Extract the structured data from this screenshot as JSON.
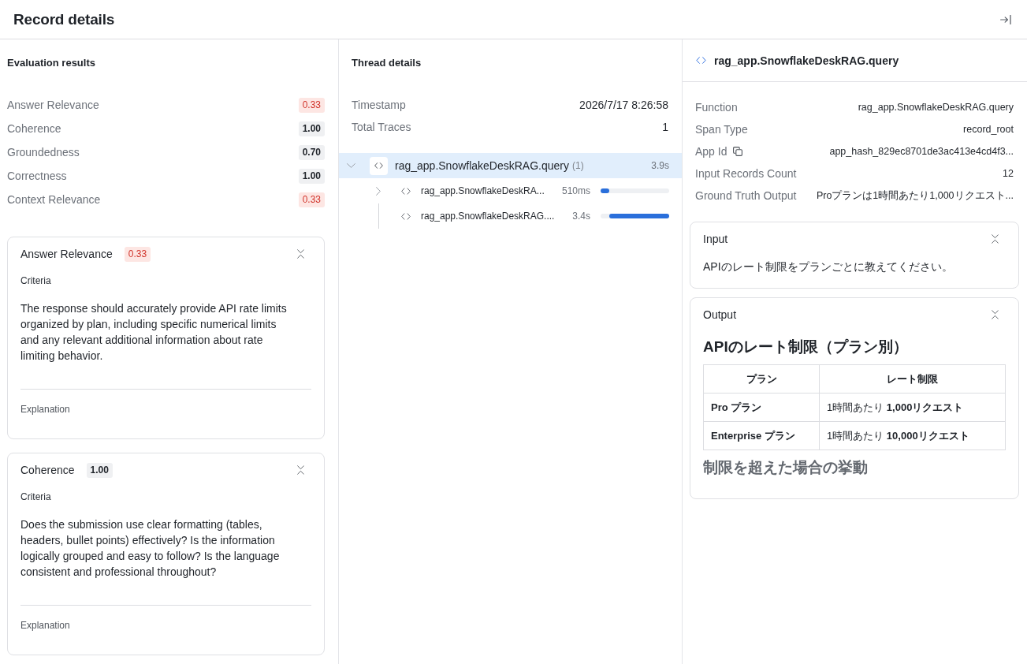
{
  "header": {
    "title": "Record details"
  },
  "evaluation": {
    "title": "Evaluation results",
    "scores": [
      {
        "name": "Answer Relevance",
        "score": "0.33",
        "flagged": true
      },
      {
        "name": "Coherence",
        "score": "1.00",
        "flagged": false
      },
      {
        "name": "Groundedness",
        "score": "0.70",
        "flagged": false
      },
      {
        "name": "Correctness",
        "score": "1.00",
        "flagged": false
      },
      {
        "name": "Context Relevance",
        "score": "0.33",
        "flagged": true
      }
    ],
    "cards": [
      {
        "name": "Answer Relevance",
        "score": "0.33",
        "flagged": true,
        "expanded": true,
        "criteria_label": "Criteria",
        "criteria": "The response should accurately provide API rate limits organized by plan, including specific numerical limits and any relevant additional information about rate limiting behavior.",
        "explanation_label": "Explanation"
      },
      {
        "name": "Coherence",
        "score": "1.00",
        "flagged": false,
        "expanded": true,
        "criteria_label": "Criteria",
        "criteria": "Does the submission use clear formatting (tables, headers, bullet points) effectively? Is the information logically grouped and easy to follow? Is the language consistent and professional throughout?",
        "explanation_label": "Explanation"
      }
    ]
  },
  "thread": {
    "title": "Thread details",
    "properties": [
      {
        "label": "Timestamp",
        "value": "2026/7/17 8:26:58"
      },
      {
        "label": "Total Traces",
        "value": "1"
      }
    ],
    "spans": [
      {
        "name": "rag_app.SnowflakeDeskRAG.query",
        "count": "(1)",
        "duration": "3.9s",
        "selected": true,
        "expanded": true,
        "children": [
          {
            "kind": "group",
            "name": "rag_app.SnowflakeDeskRA...",
            "duration": "510ms",
            "level": 0.13,
            "selected": false,
            "expanded": false
          },
          {
            "kind": "leaf",
            "name": "rag_app.SnowflakeDeskRAG....",
            "duration": "3.4s",
            "level": 0.87,
            "selected": false
          }
        ]
      }
    ]
  },
  "span_detail": {
    "title": "rag_app.SnowflakeDeskRAG.query",
    "properties": [
      {
        "label": "Function",
        "value": "rag_app.SnowflakeDeskRAG.query",
        "copyable": false
      },
      {
        "label": "Span Type",
        "value": "record_root",
        "copyable": false
      },
      {
        "label": "App Id",
        "value": "app_hash_829ec8701de3ac413e4cd4f3...",
        "copyable": true
      },
      {
        "label": "Input Records Count",
        "value": "12",
        "copyable": false
      },
      {
        "label": "Ground Truth Output",
        "value": "Proプランは1時間あたり1,000リクエスト...",
        "copyable": false
      }
    ],
    "sections": [
      {
        "kind": "text",
        "title": "Input",
        "expanded": true,
        "text": "APIのレート制限をプランごとに教えてください。"
      },
      {
        "kind": "document",
        "title": "Output",
        "expanded": true,
        "blocks": [
          {
            "kind": "heading",
            "text": "APIのレート制限（プラン別）"
          },
          {
            "kind": "table",
            "columns": [
              "プラン",
              "レート制限"
            ],
            "rows": [
              [
                "Pro プラン",
                "1時間あたり **1,000リクエスト**"
              ],
              [
                "Enterprise プラン",
                "1時間あたり **10,000リクエスト**"
              ]
            ]
          },
          {
            "kind": "heading",
            "text": "制限を超えた場合の挙動"
          }
        ]
      }
    ]
  }
}
